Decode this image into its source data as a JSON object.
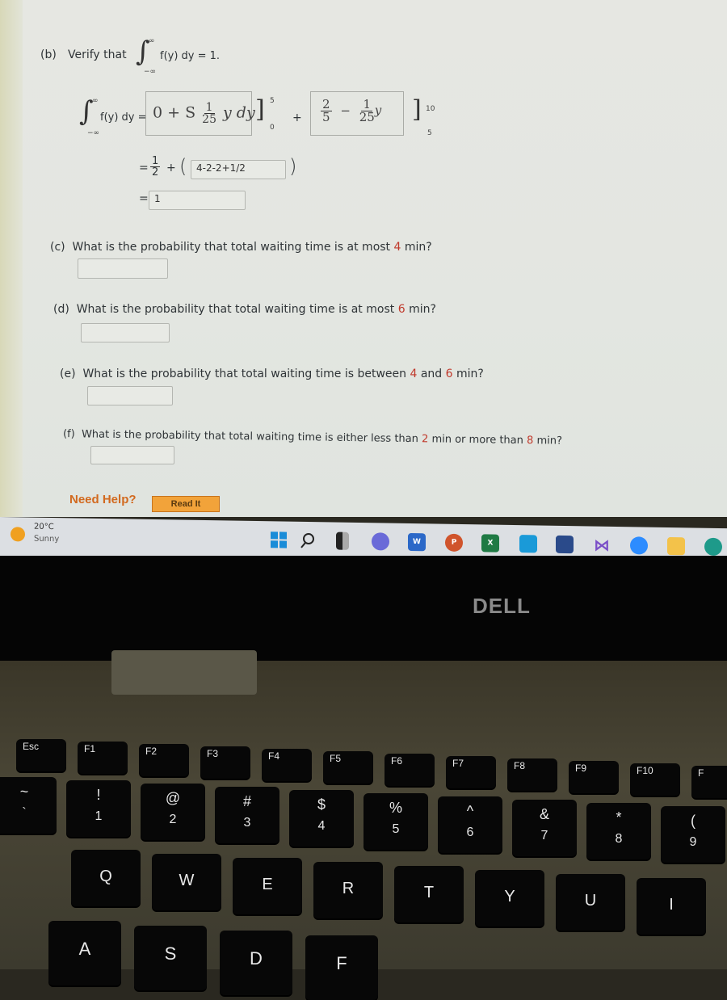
{
  "problem": {
    "part_b": {
      "label": "(b)",
      "prompt_prefix": "Verify that",
      "integrand": "f(y) dy = 1.",
      "upper_limit": "∞",
      "lower_limit": "−∞",
      "lhs_integrand": "f(y) dy =",
      "box1": {
        "lead": "0 + S",
        "frac_num": "1",
        "frac_den": "25",
        "tail": "y dy"
      },
      "bracket1_upper": "5",
      "bracket1_lower": "0",
      "plus": "+",
      "box2": {
        "frac1_num": "2",
        "frac1_den": "5",
        "minus": "−",
        "frac2_num": "1",
        "frac2_den": "25",
        "var": "y"
      },
      "bracket2_upper": "10",
      "bracket2_lower": "5",
      "step2_half_num": "1",
      "step2_half_den": "2",
      "step2_input": "4-2-2+1/2",
      "result_input": "1"
    },
    "part_c": {
      "label": "(c)",
      "text_before": "What is the probability that total waiting time is at most",
      "value": "4",
      "text_after": "min?",
      "answer": ""
    },
    "part_d": {
      "label": "(d)",
      "text_before": "What is the probability that total waiting time is at most",
      "value": "6",
      "text_after": "min?",
      "answer": ""
    },
    "part_e": {
      "label": "(e)",
      "text_before": "What is the probability that total waiting time is between",
      "value1": "4",
      "mid": "and",
      "value2": "6",
      "text_after": "min?",
      "answer": ""
    },
    "part_f": {
      "label": "(f)",
      "text_before": "What is the probability that total waiting time is either less than",
      "value1": "2",
      "mid": "min or more than",
      "value2": "8",
      "text_after": "min?",
      "answer": ""
    },
    "help": {
      "label": "Need Help?",
      "read_it": "Read It"
    }
  },
  "taskbar": {
    "weather_temp": "20°C",
    "weather_desc": "Sunny",
    "icons": [
      "windows-start",
      "search",
      "task-view",
      "teams-chat",
      "word",
      "powerpoint",
      "excel",
      "mail",
      "microsoft-store",
      "visual-studio",
      "zoom",
      "file-explorer",
      "edge"
    ],
    "word_letter": "W",
    "ppt_letter": "P",
    "excel_letter": "X"
  },
  "laptop": {
    "brand": "DELL"
  },
  "keyboard": {
    "fn_row": [
      "Esc",
      "F1",
      "F2",
      "F3",
      "F4",
      "F5",
      "F6",
      "F7",
      "F8",
      "F9",
      "F10",
      "F"
    ],
    "number_row": [
      {
        "top": "~",
        "bottom": "`"
      },
      {
        "top": "!",
        "bottom": "1"
      },
      {
        "top": "@",
        "bottom": "2"
      },
      {
        "top": "#",
        "bottom": "3"
      },
      {
        "top": "$",
        "bottom": "4"
      },
      {
        "top": "%",
        "bottom": "5"
      },
      {
        "top": "^",
        "bottom": "6"
      },
      {
        "top": "&",
        "bottom": "7"
      },
      {
        "top": "*",
        "bottom": "8"
      },
      {
        "top": "(",
        "bottom": "9"
      }
    ],
    "qwerty_row": [
      "Q",
      "W",
      "E",
      "R",
      "T",
      "Y",
      "U",
      "I"
    ],
    "home_row": [
      "A",
      "S",
      "D",
      "F"
    ]
  },
  "colors": {
    "highlight": "#c0392b",
    "help": "#d2691e",
    "read_it": "#f2a33a"
  }
}
